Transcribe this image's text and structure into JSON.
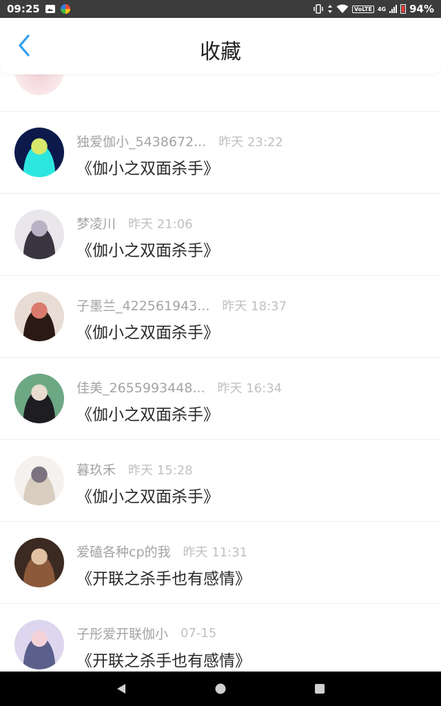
{
  "status_bar": {
    "time": "09:25",
    "network_badge": "VoLTE",
    "network_type": "4G",
    "battery_percent": "94%",
    "icons": [
      "gallery-icon",
      "app-icon",
      "vibrate-icon",
      "data-arrows-icon",
      "wifi-icon",
      "signal-icon",
      "battery-icon"
    ]
  },
  "header": {
    "title": "收藏",
    "back_icon": "chevron-left-icon",
    "accent_color": "#2a9df4"
  },
  "favorites": [
    {
      "user": "独爱伽小_5438672...",
      "time": "昨天 23:22",
      "book": "《伽小之双面杀手》",
      "avatar_colors": [
        "#0b1a4a",
        "#2ee6e0",
        "#d7e86b"
      ]
    },
    {
      "user": "梦凌川",
      "time": "昨天 21:06",
      "book": "《伽小之双面杀手》",
      "avatar_colors": [
        "#e9e6ec",
        "#3a3440",
        "#b8b2c4"
      ]
    },
    {
      "user": "子墨兰_422561943...",
      "time": "昨天 18:37",
      "book": "《伽小之双面杀手》",
      "avatar_colors": [
        "#e8dcd4",
        "#2b1a14",
        "#d97a6c"
      ]
    },
    {
      "user": "佳美_2655993448...",
      "time": "昨天 16:34",
      "book": "《伽小之双面杀手》",
      "avatar_colors": [
        "#6da884",
        "#1d1d22",
        "#e8dccf"
      ]
    },
    {
      "user": "暮玖禾",
      "time": "昨天 15:28",
      "book": "《伽小之双面杀手》",
      "avatar_colors": [
        "#f5f1ee",
        "#d9cdbf",
        "#7b7480"
      ]
    },
    {
      "user": "爱磕各种cp的我",
      "time": "昨天 11:31",
      "book": "《开联之杀手也有感情》",
      "avatar_colors": [
        "#3b2a22",
        "#8c5a3a",
        "#e0c2a2"
      ]
    },
    {
      "user": "子彤爱开联伽小",
      "time": "07-15",
      "book": "《开联之杀手也有感情》",
      "avatar_colors": [
        "#ddd6ee",
        "#5a5f8c",
        "#f2d2d8"
      ]
    }
  ],
  "nav_bar": {
    "icons": [
      "back-triangle-icon",
      "home-circle-icon",
      "recents-square-icon"
    ]
  }
}
